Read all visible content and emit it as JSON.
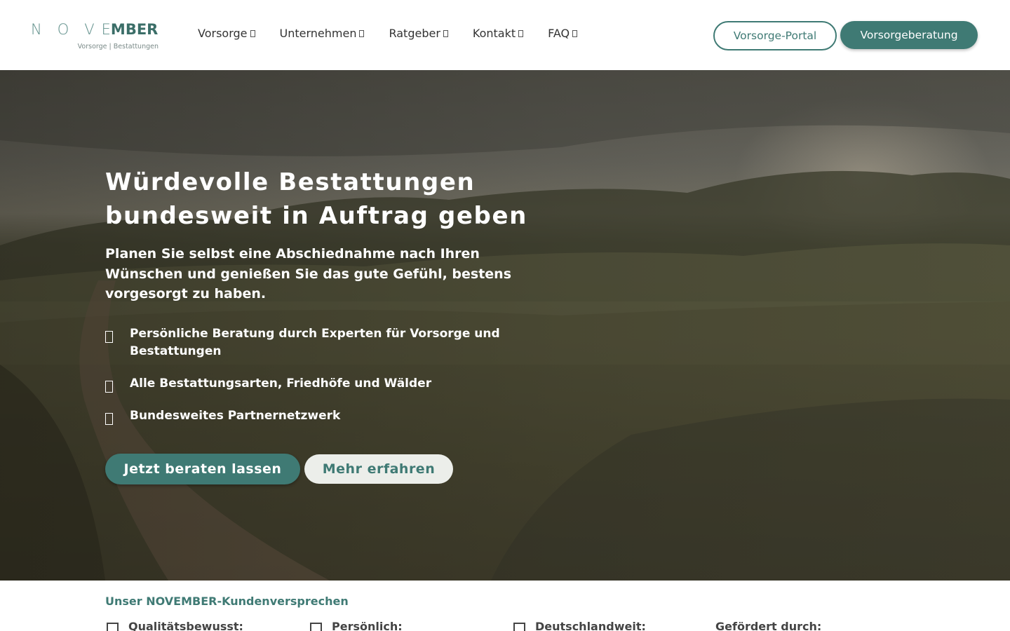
{
  "logo": {
    "letters": [
      "N",
      "O",
      "V",
      "E",
      "M",
      "BER"
    ],
    "tagline": "Vorsorge | Bestattungen"
  },
  "nav": {
    "items": [
      {
        "label": "Vorsorge"
      },
      {
        "label": "Unternehmen"
      },
      {
        "label": "Ratgeber"
      },
      {
        "label": "Kontakt"
      },
      {
        "label": "FAQ"
      }
    ]
  },
  "header_buttons": {
    "portal": "Vorsorge-Portal",
    "beratung": "Vorsorgeberatung"
  },
  "hero": {
    "title_line1": "Würdevolle Bestattungen",
    "title_line2": "bundesweit in Auftrag geben",
    "subtitle_line1": "Planen Sie selbst eine Abschiednahme nach Ihren",
    "subtitle_line2": "Wünschen und genießen Sie das gute Gefühl, bestens",
    "subtitle_line3": "vorgesorgt zu haben.",
    "bullets": [
      {
        "line1": "Persönliche Beratung durch Experten für Vorsorge und",
        "line2": "Bestattungen"
      },
      {
        "line1": "Alle Bestattungsarten, Friedhöfe und Wälder"
      },
      {
        "line1": "Bundesweites Partnernetzwerk"
      }
    ],
    "cta_primary": "Jetzt beraten lassen",
    "cta_secondary": "Mehr erfahren"
  },
  "promise": {
    "title": "Unser NOVEMBER-Kundenversprechen",
    "items": [
      {
        "label": "Qualitätsbewusst:"
      },
      {
        "label": "Persönlich:"
      },
      {
        "label": "Deutschlandweit:"
      },
      {
        "label": "Gefördert durch:"
      }
    ]
  },
  "colors": {
    "brand": "#3f7a74",
    "white": "#ffffff",
    "secondary_button_bg": "#eceeea"
  }
}
